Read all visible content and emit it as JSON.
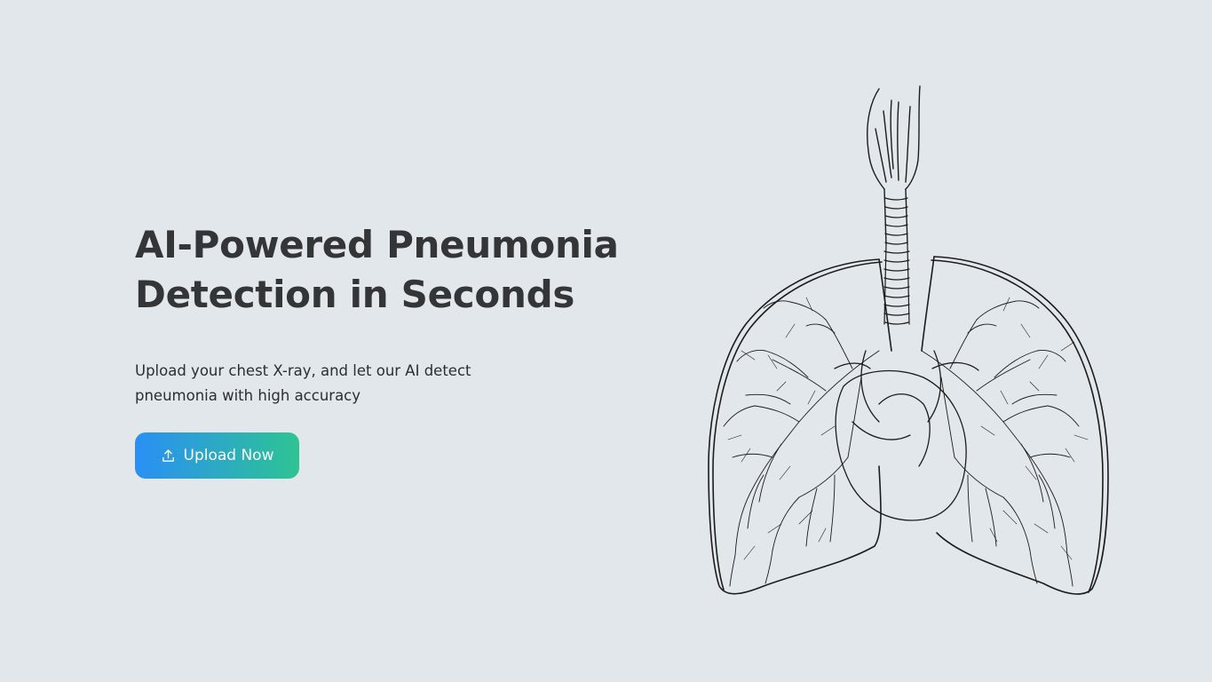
{
  "hero": {
    "title_line1": "AI-Powered Pneumonia",
    "title_line2": "Detection in Seconds",
    "subtitle": "Upload your chest X-ray, and let our AI detect pneumonia with high accuracy",
    "upload_button_label": "Upload Now",
    "upload_icon": "upload-icon",
    "illustration": "lungs-illustration"
  },
  "colors": {
    "background": "#e2e7ec",
    "title": "#333536",
    "button_gradient_start": "#2a8ff5",
    "button_gradient_end": "#2dc493",
    "button_text": "#ffffff"
  }
}
